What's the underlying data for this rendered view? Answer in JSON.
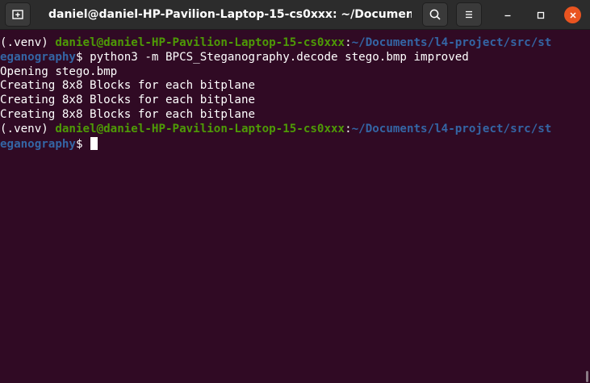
{
  "window": {
    "title": "daniel@daniel-HP-Pavilion-Laptop-15-cs0xxx: ~/Documents/...",
    "accent_close": "#e95420",
    "background": "#300a24"
  },
  "icons": {
    "new_tab": "new-tab-icon",
    "search": "search-icon",
    "menu": "hamburger-menu-icon",
    "minimize": "minimize-icon",
    "maximize": "maximize-icon",
    "close": "close-icon"
  },
  "terminal": {
    "venv": "(.venv) ",
    "user_host": "daniel@daniel-HP-Pavilion-Laptop-15-cs0xxx",
    "colon": ":",
    "cwd_line1": "~/Documents/l4-project/src/st",
    "cwd_line2": "eganography",
    "prompt_symbol": "$ ",
    "command": "python3 -m BPCS_Steganography.decode stego.bmp improved",
    "output": [
      "Opening stego.bmp",
      "Creating 8x8 Blocks for each bitplane",
      "Creating 8x8 Blocks for each bitplane",
      "Creating 8x8 Blocks for each bitplane"
    ],
    "colors": {
      "user": "#4e9a06",
      "path": "#3465a4",
      "text": "#ffffff"
    }
  }
}
